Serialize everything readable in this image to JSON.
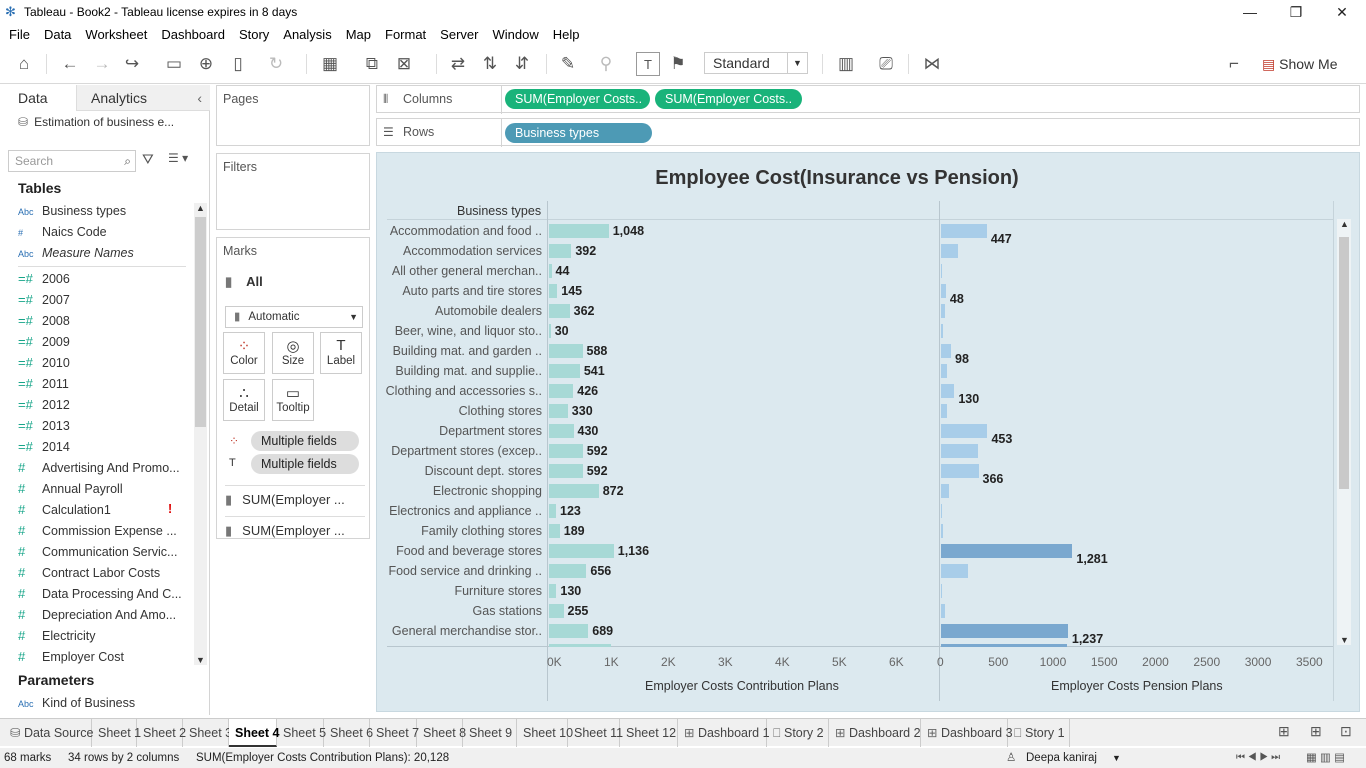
{
  "window": {
    "title": "Tableau - Book2 - Tableau license expires in 8 days"
  },
  "menu": [
    "File",
    "Data",
    "Worksheet",
    "Dashboard",
    "Story",
    "Analysis",
    "Map",
    "Format",
    "Server",
    "Window",
    "Help"
  ],
  "toolbar": {
    "fit": "Standard",
    "show_me": "Show Me"
  },
  "datapane": {
    "tab_data": "Data",
    "tab_analytics": "Analytics",
    "datasource": "Estimation of business e...",
    "search_placeholder": "Search",
    "tables_header": "Tables",
    "parameters_header": "Parameters",
    "dims": [
      {
        "icon": "Abc",
        "name": "Business types"
      },
      {
        "icon": "#",
        "name": "Naics Code"
      },
      {
        "icon": "Abc",
        "name": "Measure Names"
      }
    ],
    "measures": [
      "2006",
      "2007",
      "2008",
      "2009",
      "2010",
      "2011",
      "2012",
      "2013",
      "2014",
      "Advertising And Promo...",
      "Annual Payroll",
      "Calculation1",
      "Commission Expense ...",
      "Communication Servic...",
      "Contract Labor Costs",
      "Data Processing And C...",
      "Depreciation And Amo...",
      "Electricity",
      "Employer Cost"
    ],
    "parameters": [
      "Kind of Business"
    ]
  },
  "shelves": {
    "pages": "Pages",
    "filters": "Filters",
    "columns": "Columns",
    "rows": "Rows",
    "col_pill1": "SUM(Employer Costs..",
    "col_pill2": "SUM(Employer Costs..",
    "row_pill": "Business types"
  },
  "marks": {
    "title": "Marks",
    "all": "All",
    "type": "Automatic",
    "color": "Color",
    "size": "Size",
    "label": "Label",
    "detail": "Detail",
    "tooltip": "Tooltip",
    "multi1": "Multiple fields",
    "multi2": "Multiple fields",
    "sum1": "SUM(Employer ...",
    "sum2": "SUM(Employer ..."
  },
  "chart_data": {
    "type": "bar",
    "title": "Employee Cost(Insurance vs Pension)",
    "row_header": "Business types",
    "categories": [
      "Accommodation and food ..",
      "Accommodation services",
      "All other general merchan..",
      "Auto parts and tire stores",
      "Automobile dealers",
      "Beer, wine, and liquor sto..",
      "Building mat. and garden ..",
      "Building mat. and supplie..",
      "Clothing and accessories s..",
      "Clothing stores",
      "Department stores",
      "Department stores (excep..",
      "Discount dept. stores",
      "Electronic shopping",
      "Electronics and appliance ..",
      "Family clothing stores",
      "Food and beverage stores",
      "Food service and drinking ..",
      "Furniture stores",
      "Gas stations",
      "General merchandise stor.."
    ],
    "series": [
      {
        "name": "Employer Costs Contribution Plans",
        "values": [
          1048,
          392,
          44,
          145,
          362,
          30,
          588,
          541,
          426,
          330,
          430,
          592,
          592,
          872,
          123,
          189,
          1136,
          656,
          130,
          255,
          689
        ],
        "labels": [
          "1,048",
          "392",
          "44",
          "145",
          "362",
          "30",
          "588",
          "541",
          "426",
          "330",
          "430",
          "592",
          "592",
          "872",
          "123",
          "189",
          "1,136",
          "656",
          "130",
          "255",
          "689"
        ],
        "ticks": [
          "0K",
          "1K",
          "2K",
          "3K",
          "4K",
          "5K",
          "6K"
        ],
        "xlim": [
          0,
          6500
        ]
      },
      {
        "name": "Employer Costs Pension Plans",
        "values": [
          447,
          162,
          8,
          48,
          40,
          18,
          98,
          60,
          130,
          60,
          453,
          362,
          366,
          80,
          5,
          22,
          1281,
          262,
          10,
          40,
          1237
        ],
        "labels": [
          "447",
          "",
          "",
          "48",
          "",
          "",
          "98",
          "",
          "130",
          "",
          "453",
          "",
          "366",
          "",
          "",
          "",
          "1,281",
          "",
          "",
          "",
          "1,237"
        ],
        "ticks": [
          "0",
          "500",
          "1000",
          "1500",
          "2000",
          "2500",
          "3000",
          "3500"
        ],
        "xlim": [
          0,
          3700
        ]
      }
    ],
    "dark_bars": [
      16,
      20
    ]
  },
  "tabs": [
    "Data Source",
    "Sheet 1",
    "Sheet 2",
    "Sheet 3",
    "Sheet 4",
    "Sheet 5",
    "Sheet 6",
    "Sheet 7",
    "Sheet 8",
    "Sheet 9",
    "Sheet 10",
    "Sheet 11",
    "Sheet 12",
    "Dashboard 1",
    "Story 2",
    "Dashboard 2",
    "Dashboard 3",
    "Story 1"
  ],
  "active_tab": "Sheet 4",
  "status": {
    "marks": "68 marks",
    "dims": "34 rows by 2 columns",
    "sum": "SUM(Employer Costs Contribution Plans): 20,128",
    "user": "Deepa kaniraj"
  }
}
